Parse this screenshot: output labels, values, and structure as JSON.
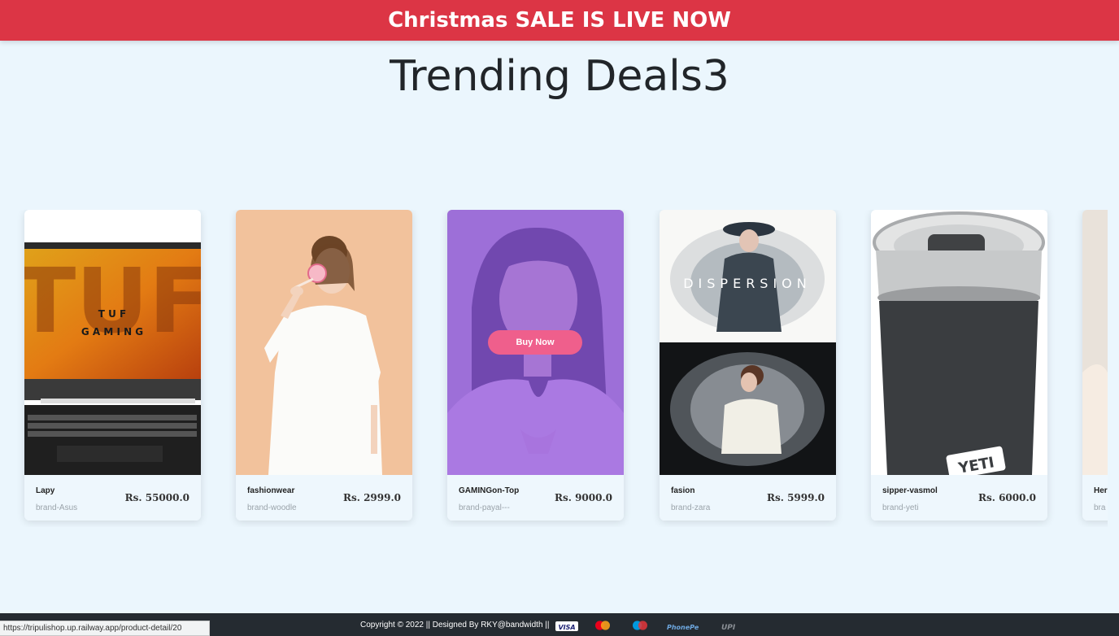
{
  "banner": {
    "text": "Christmas SALE IS LIVE NOW"
  },
  "title": "Trending Deals3",
  "products": [
    {
      "name": "Lapy",
      "brand": "brand-Asus",
      "price": "Rs. 55000.0"
    },
    {
      "name": "fashionwear",
      "brand": "brand-woodle",
      "price": "Rs. 2999.0"
    },
    {
      "name": "GAMINGon-Top",
      "brand": "brand-payal---",
      "price": "Rs. 9000.0",
      "button": "Buy Now"
    },
    {
      "name": "fasion",
      "brand": "brand-zara",
      "price": "Rs. 5999.0"
    },
    {
      "name": "sipper-vasmol",
      "brand": "brand-yeti",
      "price": "Rs. 6000.0"
    },
    {
      "name": "Her",
      "brand": "bra"
    }
  ],
  "images": {
    "laptop_text_top": "TUF",
    "laptop_text_mid": "T U F",
    "laptop_text_gaming": "G A M I N G",
    "dispersion_text": "DISPERSION",
    "tumbler_logo": "YETI"
  },
  "footer": {
    "copyright": "Copyright © 2022 || Designed By RKY@bandwidth ||"
  },
  "payments": [
    "VISA",
    "mastercard",
    "maestro",
    "PhonePe",
    "UPI"
  ],
  "status_bar": {
    "url": "https://tripulishop.up.railway.app/product-detail/20"
  },
  "colors": {
    "banner": "#dc3545",
    "background": "#ebf6fd",
    "footer": "#252b31",
    "buy_button": "#ef5f8c"
  }
}
